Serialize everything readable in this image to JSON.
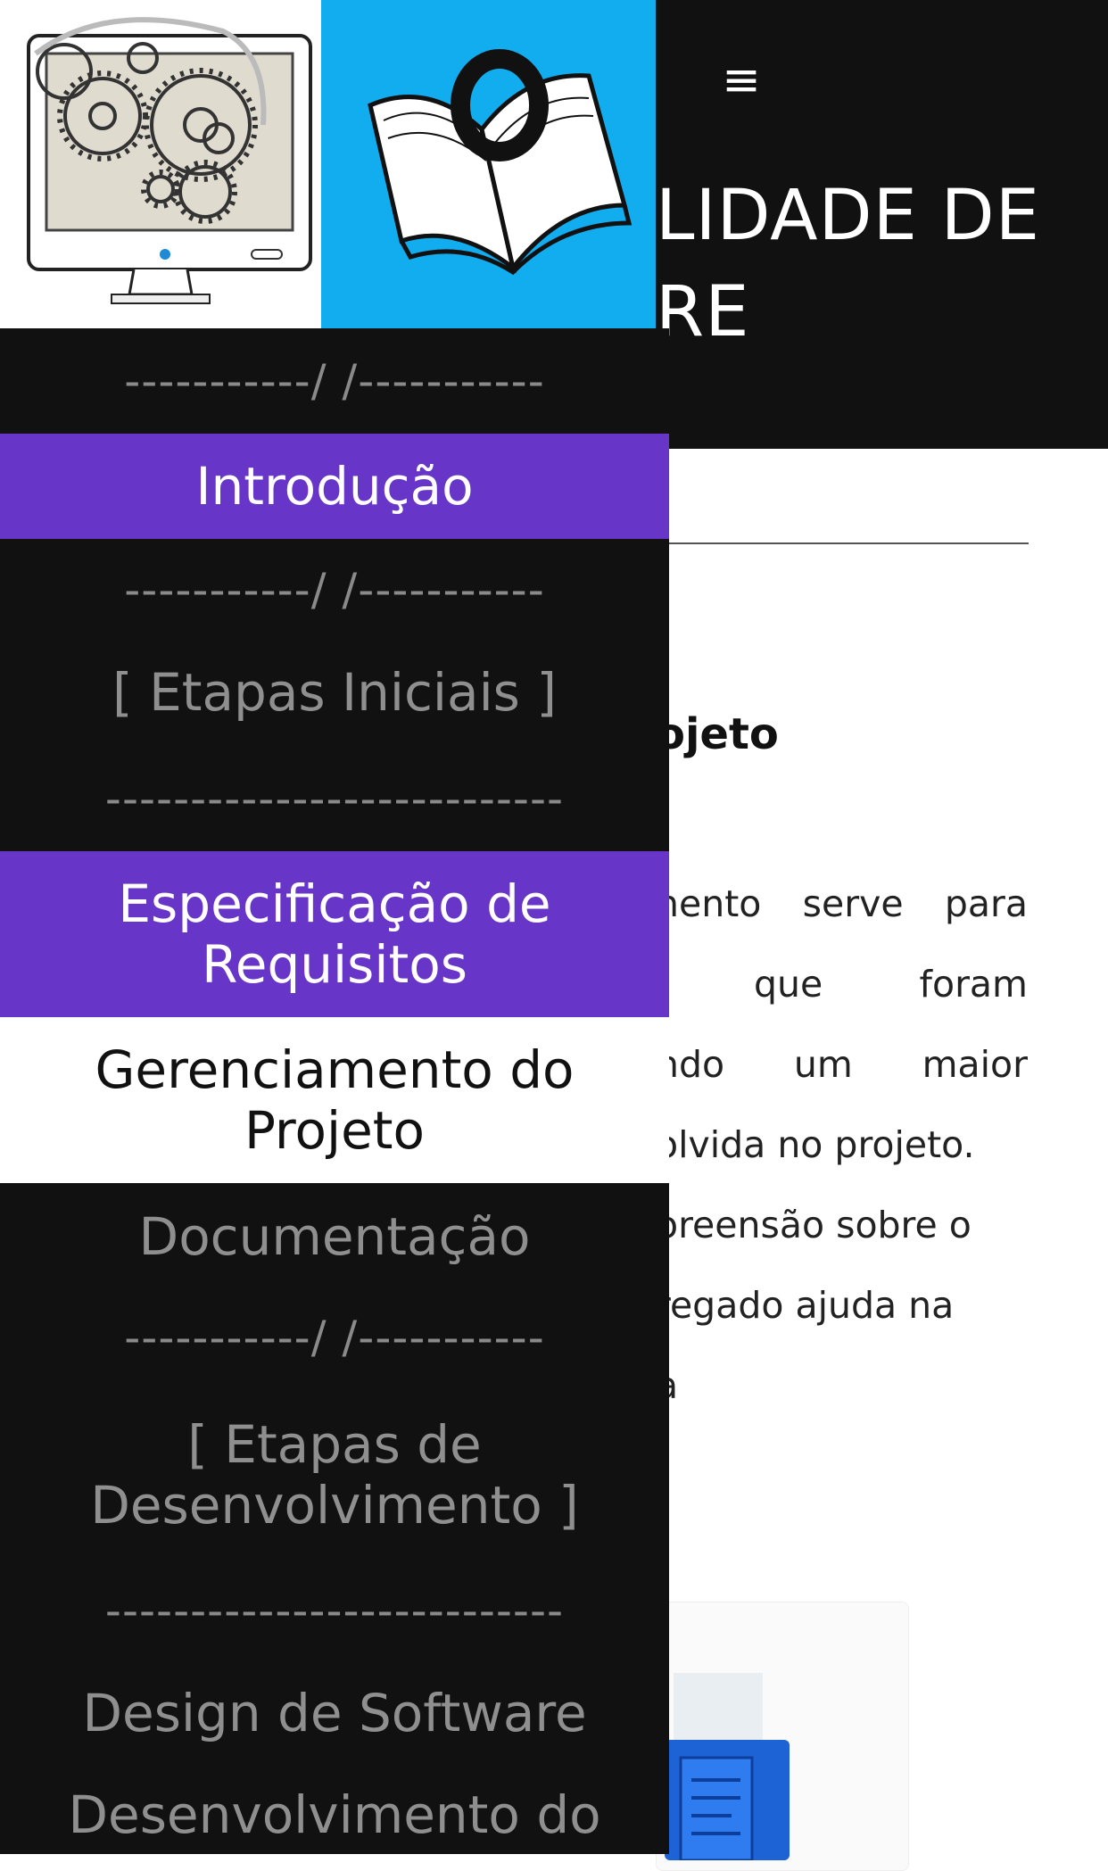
{
  "header": {
    "menu_icon": "menu-icon",
    "title_line1": "LIDADE DE",
    "title_line2": "RE"
  },
  "content": {
    "section_title": "ojeto",
    "paragraph_lines": [
      [
        "nento",
        "serve",
        "para"
      ],
      [
        "que",
        "foram"
      ],
      [
        "ndo",
        "um",
        "maior"
      ],
      [
        "olvida no projeto."
      ],
      [
        "oreensão sobre o"
      ],
      [
        "regado ajuda na"
      ],
      [
        "a"
      ]
    ]
  },
  "logos": {
    "gears_logo": "computer-gears-logo",
    "book_logo": "open-book-logo"
  },
  "drawer": {
    "sep_short": "-----------/ /-----------",
    "sep_long": "---------------------------",
    "intro": "Introdução",
    "etapas_iniciais": "[ Etapas Iniciais ]",
    "especificacao": "Especificação de Requisitos",
    "gerenciamento": "Gerenciamento do Projeto",
    "documentacao": "Documentação",
    "etapas_desenvolvimento": "[ Etapas de Desenvolvimento ]",
    "design": "Design de Software",
    "desenvolvimento": "Desenvolvimento do"
  },
  "colors": {
    "drawer_bg": "#111111",
    "active_purple": "#6835c9",
    "book_bg": "#12adef"
  }
}
